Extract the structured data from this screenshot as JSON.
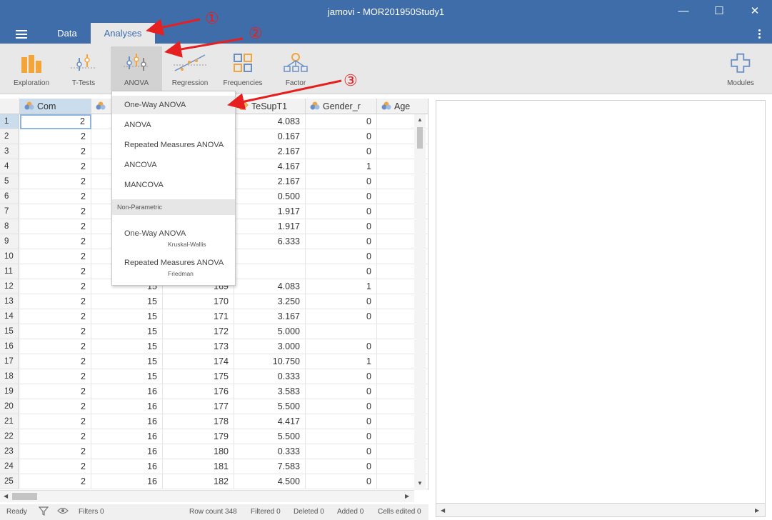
{
  "window": {
    "title": "jamovi - MOR201950Study1",
    "minimize_glyph": "—",
    "maximize_glyph": "☐",
    "close_glyph": "✕"
  },
  "tabs": [
    {
      "label": "Data"
    },
    {
      "label": "Analyses"
    }
  ],
  "ribbon": {
    "buttons": [
      {
        "label": "Exploration",
        "icon": "exploration-icon"
      },
      {
        "label": "T-Tests",
        "icon": "ttests-icon"
      },
      {
        "label": "ANOVA",
        "icon": "anova-icon"
      },
      {
        "label": "Regression",
        "icon": "regression-icon"
      },
      {
        "label": "Frequencies",
        "icon": "frequencies-icon"
      },
      {
        "label": "Factor",
        "icon": "factor-icon"
      }
    ],
    "modules": {
      "label": "Modules",
      "icon": "plus-icon"
    }
  },
  "columns": [
    "Com",
    "",
    "",
    "TeSupT1",
    "Gender_r",
    "Age"
  ],
  "rows": [
    [
      "1",
      "2",
      "",
      "",
      "4.083",
      "0"
    ],
    [
      "2",
      "2",
      "",
      "",
      "0.167",
      "0"
    ],
    [
      "3",
      "2",
      "",
      "",
      "2.167",
      "0"
    ],
    [
      "4",
      "2",
      "",
      "",
      "4.167",
      "1"
    ],
    [
      "5",
      "2",
      "",
      "",
      "2.167",
      "0"
    ],
    [
      "6",
      "2",
      "",
      "",
      "0.500",
      "0"
    ],
    [
      "7",
      "2",
      "",
      "",
      "1.917",
      "0"
    ],
    [
      "8",
      "2",
      "",
      "",
      "1.917",
      "0"
    ],
    [
      "9",
      "2",
      "",
      "",
      "6.333",
      "0"
    ],
    [
      "10",
      "2",
      "",
      "",
      "",
      "0"
    ],
    [
      "11",
      "2",
      "",
      "",
      "",
      "0"
    ],
    [
      "12",
      "2",
      "15",
      "169",
      "4.083",
      "1"
    ],
    [
      "13",
      "2",
      "15",
      "170",
      "3.250",
      "0"
    ],
    [
      "14",
      "2",
      "15",
      "171",
      "3.167",
      "0"
    ],
    [
      "15",
      "2",
      "15",
      "172",
      "5.000",
      ""
    ],
    [
      "16",
      "2",
      "15",
      "173",
      "3.000",
      "0"
    ],
    [
      "17",
      "2",
      "15",
      "174",
      "10.750",
      "1"
    ],
    [
      "18",
      "2",
      "15",
      "175",
      "0.333",
      "0"
    ],
    [
      "19",
      "2",
      "16",
      "176",
      "3.583",
      "0"
    ],
    [
      "20",
      "2",
      "16",
      "177",
      "5.500",
      "0"
    ],
    [
      "21",
      "2",
      "16",
      "178",
      "4.417",
      "0"
    ],
    [
      "22",
      "2",
      "16",
      "179",
      "5.500",
      "0"
    ],
    [
      "23",
      "2",
      "16",
      "180",
      "0.333",
      "0"
    ],
    [
      "24",
      "2",
      "16",
      "181",
      "7.583",
      "0"
    ],
    [
      "25",
      "2",
      "16",
      "182",
      "4.500",
      "0"
    ]
  ],
  "anova_menu": {
    "items": [
      "One-Way ANOVA",
      "ANOVA",
      "Repeated Measures ANOVA",
      "ANCOVA",
      "MANCOVA"
    ],
    "section_label": "Non-Parametric",
    "nonparam": [
      {
        "label": "One-Way ANOVA",
        "sub": "Kruskal-Wallis"
      },
      {
        "label": "Repeated Measures ANOVA",
        "sub": "Friedman"
      }
    ]
  },
  "status": {
    "ready": "Ready",
    "filters": "Filters 0",
    "row_count": "Row count 348",
    "filtered": "Filtered 0",
    "deleted": "Deleted 0",
    "added": "Added 0",
    "cells_edited": "Cells edited 0"
  },
  "annotations": [
    "①",
    "②",
    "③"
  ],
  "colors": {
    "brand": "#3e6da9",
    "ribbon_bg": "#e8e8e8",
    "accent_orange": "#f3a53a",
    "annotation_red": "#e62020"
  }
}
